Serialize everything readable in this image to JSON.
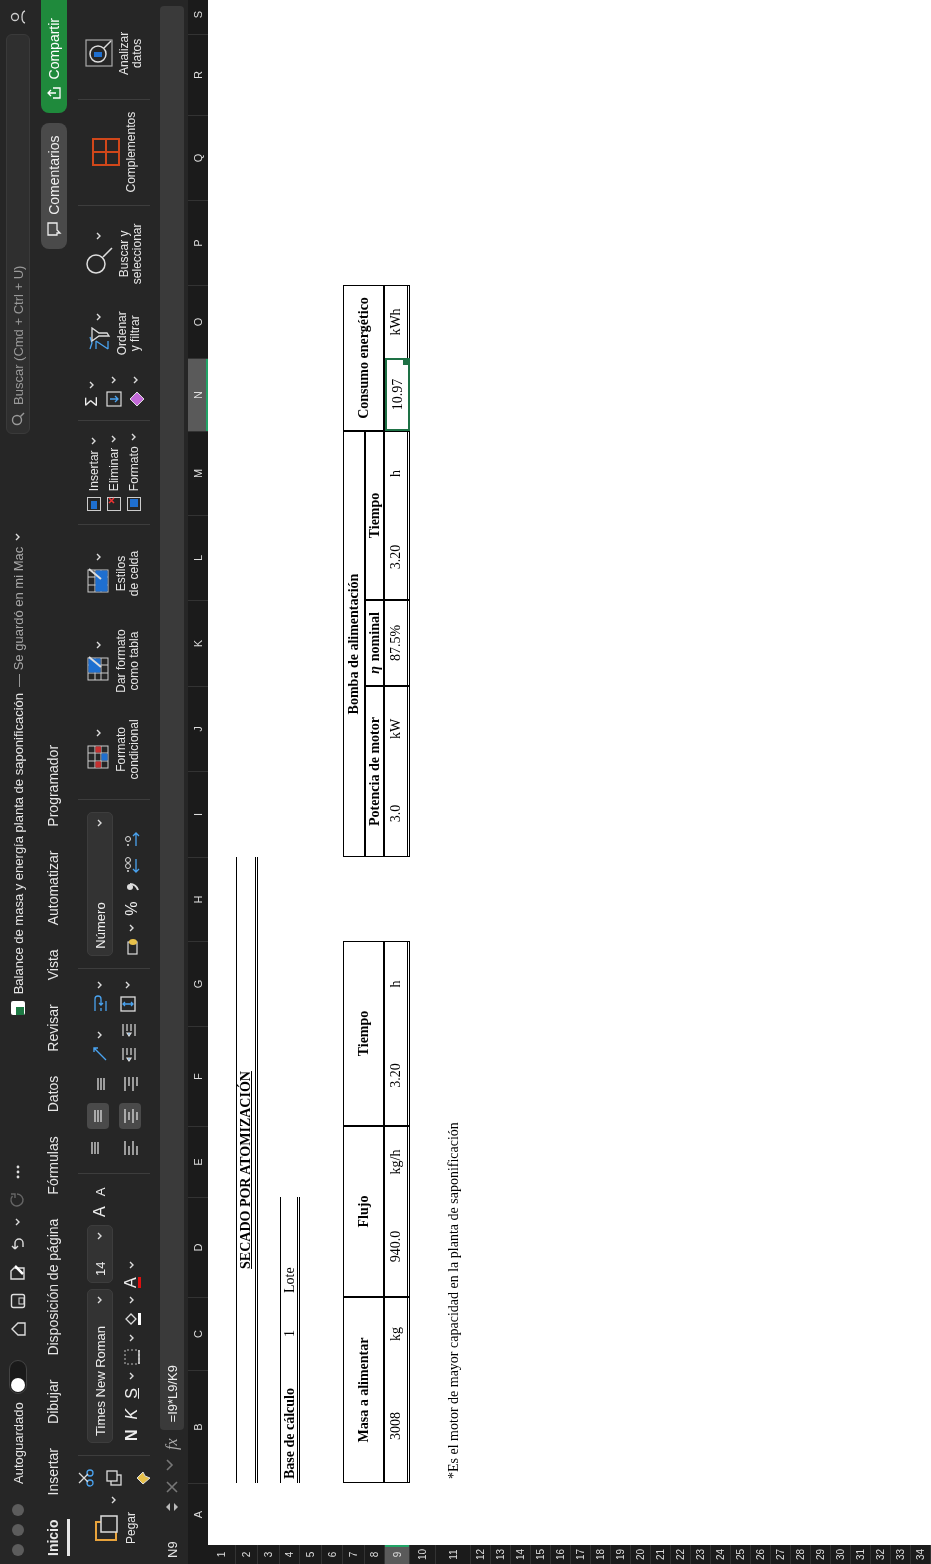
{
  "window": {
    "autosave_label": "Autoguardado",
    "autosave_on": false,
    "title": "Balance de masa y energía planta de saponificación",
    "save_status": "— Se guardó en mi Mac",
    "search": {
      "placeholder": "Buscar (Cmd + Ctrl + U)"
    }
  },
  "tabs": [
    {
      "label": "Inicio",
      "selected": true
    },
    {
      "label": "Insertar",
      "selected": false
    },
    {
      "label": "Dibujar",
      "selected": false
    },
    {
      "label": "Disposición de página",
      "selected": false
    },
    {
      "label": "Fórmulas",
      "selected": false
    },
    {
      "label": "Datos",
      "selected": false
    },
    {
      "label": "Revisar",
      "selected": false
    },
    {
      "label": "Vista",
      "selected": false
    },
    {
      "label": "Automatizar",
      "selected": false
    },
    {
      "label": "Programador",
      "selected": false
    }
  ],
  "comments_button": "Comentarios",
  "share_button": "Compartir",
  "ribbon": {
    "paste": "Pegar",
    "font_name": "Times New Roman",
    "font_size": "14",
    "grow_font": "A",
    "shrink_font": "A",
    "bold": "N",
    "italic": "K",
    "underline": "S",
    "font_color": "A",
    "alignment": [
      {
        "kind": "top",
        "selected": false
      },
      {
        "kind": "middle",
        "selected": true
      },
      {
        "kind": "bottom",
        "selected": false
      },
      {
        "kind": "left",
        "selected": false
      },
      {
        "kind": "center",
        "selected": true
      },
      {
        "kind": "right",
        "selected": false
      }
    ],
    "number_format": "Número",
    "percent": "%",
    "styles": [
      "Formato condicional",
      "Dar formato como tabla",
      "Estilos de celda"
    ],
    "cells": [
      "Insertar",
      "Eliminar",
      "Formato"
    ],
    "autosum": "Σ",
    "sort": "Ordenar y filtrar",
    "find": "Buscar y seleccionar",
    "addins": "Complementos",
    "analyze": "Analizar datos"
  },
  "formula_bar": {
    "cell_name": "N9",
    "fx": "fx",
    "formula": "=I9*L9/K9"
  },
  "columns": [
    {
      "label": "A",
      "selected": false
    },
    {
      "label": "B",
      "selected": false
    },
    {
      "label": "C",
      "selected": false
    },
    {
      "label": "D",
      "selected": false
    },
    {
      "label": "E",
      "selected": false
    },
    {
      "label": "F",
      "selected": false
    },
    {
      "label": "G",
      "selected": false
    },
    {
      "label": "H",
      "selected": false
    },
    {
      "label": "I",
      "selected": false
    },
    {
      "label": "J",
      "selected": false
    },
    {
      "label": "K",
      "selected": false
    },
    {
      "label": "L",
      "selected": false
    },
    {
      "label": "M",
      "selected": false
    },
    {
      "label": "N",
      "selected": true
    },
    {
      "label": "O",
      "selected": false
    },
    {
      "label": "P",
      "selected": false
    },
    {
      "label": "Q",
      "selected": false
    },
    {
      "label": "R",
      "selected": false
    },
    {
      "label": "S",
      "selected": false
    }
  ],
  "rows": [
    {
      "label": "1",
      "selected": false
    },
    {
      "label": "2",
      "selected": false
    },
    {
      "label": "3",
      "selected": false
    },
    {
      "label": "4",
      "selected": false
    },
    {
      "label": "5",
      "selected": false
    },
    {
      "label": "6",
      "selected": false
    },
    {
      "label": "7",
      "selected": false
    },
    {
      "label": "8",
      "selected": false
    },
    {
      "label": "9",
      "selected": true
    },
    {
      "label": "10",
      "selected": false
    },
    {
      "label": "11",
      "selected": false
    },
    {
      "label": "12",
      "selected": false
    },
    {
      "label": "13",
      "selected": false
    },
    {
      "label": "14",
      "selected": false
    },
    {
      "label": "15",
      "selected": false
    },
    {
      "label": "16",
      "selected": false
    },
    {
      "label": "17",
      "selected": false
    },
    {
      "label": "18",
      "selected": false
    },
    {
      "label": "19",
      "selected": false
    },
    {
      "label": "20",
      "selected": false
    },
    {
      "label": "21",
      "selected": false
    },
    {
      "label": "22",
      "selected": false
    },
    {
      "label": "23",
      "selected": false
    },
    {
      "label": "24",
      "selected": false
    },
    {
      "label": "25",
      "selected": false
    },
    {
      "label": "26",
      "selected": false
    },
    {
      "label": "27",
      "selected": false
    },
    {
      "label": "28",
      "selected": false
    },
    {
      "label": "29",
      "selected": false
    },
    {
      "label": "30",
      "selected": false
    },
    {
      "label": "31",
      "selected": false
    },
    {
      "label": "32",
      "selected": false
    },
    {
      "label": "33",
      "selected": false
    },
    {
      "label": "34",
      "selected": false
    }
  ],
  "sheet": {
    "title": "SECADO POR ATOMIZACIÓN",
    "basis": {
      "label": "Base de cálculo",
      "value": "1",
      "unit": "Lote"
    },
    "feed_table": {
      "headers": [
        "Masa a alimentar",
        "Flujo",
        "Tiempo"
      ],
      "values": [
        {
          "text": "3008",
          "selected": false
        },
        {
          "text": "kg",
          "selected": false
        },
        {
          "text": "940.0",
          "selected": false
        },
        {
          "text": "kg/h",
          "selected": false
        },
        {
          "text": "3.20",
          "selected": false
        },
        {
          "text": "h",
          "selected": false
        }
      ]
    },
    "pump_table": {
      "group_header": "Bomba de alimentación",
      "headers": [
        "Potencia de motor",
        "*η* nominal",
        "Tiempo"
      ],
      "result_header": "Consumo energético",
      "values": [
        {
          "text": "3.0",
          "selected": false
        },
        {
          "text": "kW",
          "selected": false
        },
        {
          "text": "87.5%",
          "selected": false
        },
        {
          "text": "3.20",
          "selected": false
        },
        {
          "text": "h",
          "selected": false
        },
        {
          "text": "10.97",
          "selected": true
        },
        {
          "text": "kWh",
          "selected": false
        }
      ]
    },
    "footnote": "*Es el motor de mayor capacidad en la planta de saponificación"
  }
}
